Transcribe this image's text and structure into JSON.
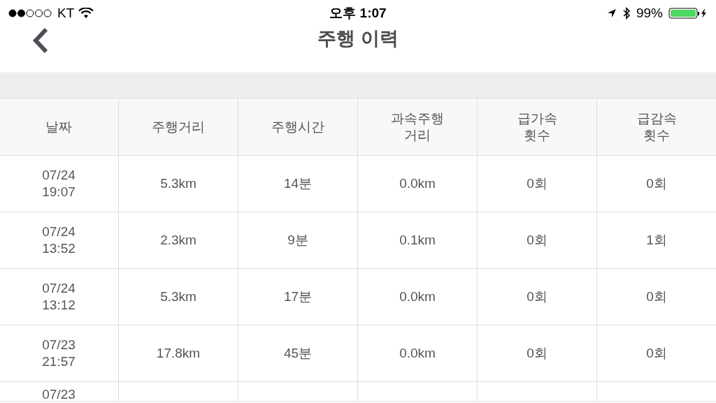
{
  "status_bar": {
    "carrier": "KT",
    "time": "오후 1:07",
    "battery": "99%"
  },
  "nav": {
    "title": "주행 이력"
  },
  "table": {
    "columns": [
      "날짜",
      "주행거리",
      "주행시간",
      "과속주행\n거리",
      "급가속\n횟수",
      "급감속\n횟수"
    ],
    "rows": [
      [
        "07/24\n19:07",
        "5.3km",
        "14분",
        "0.0km",
        "0회",
        "0회"
      ],
      [
        "07/24\n13:52",
        "2.3km",
        "9분",
        "0.1km",
        "0회",
        "1회"
      ],
      [
        "07/24\n13:12",
        "5.3km",
        "17분",
        "0.0km",
        "0회",
        "0회"
      ],
      [
        "07/23\n21:57",
        "17.8km",
        "45분",
        "0.0km",
        "0회",
        "0회"
      ],
      [
        "07/23"
      ]
    ]
  }
}
